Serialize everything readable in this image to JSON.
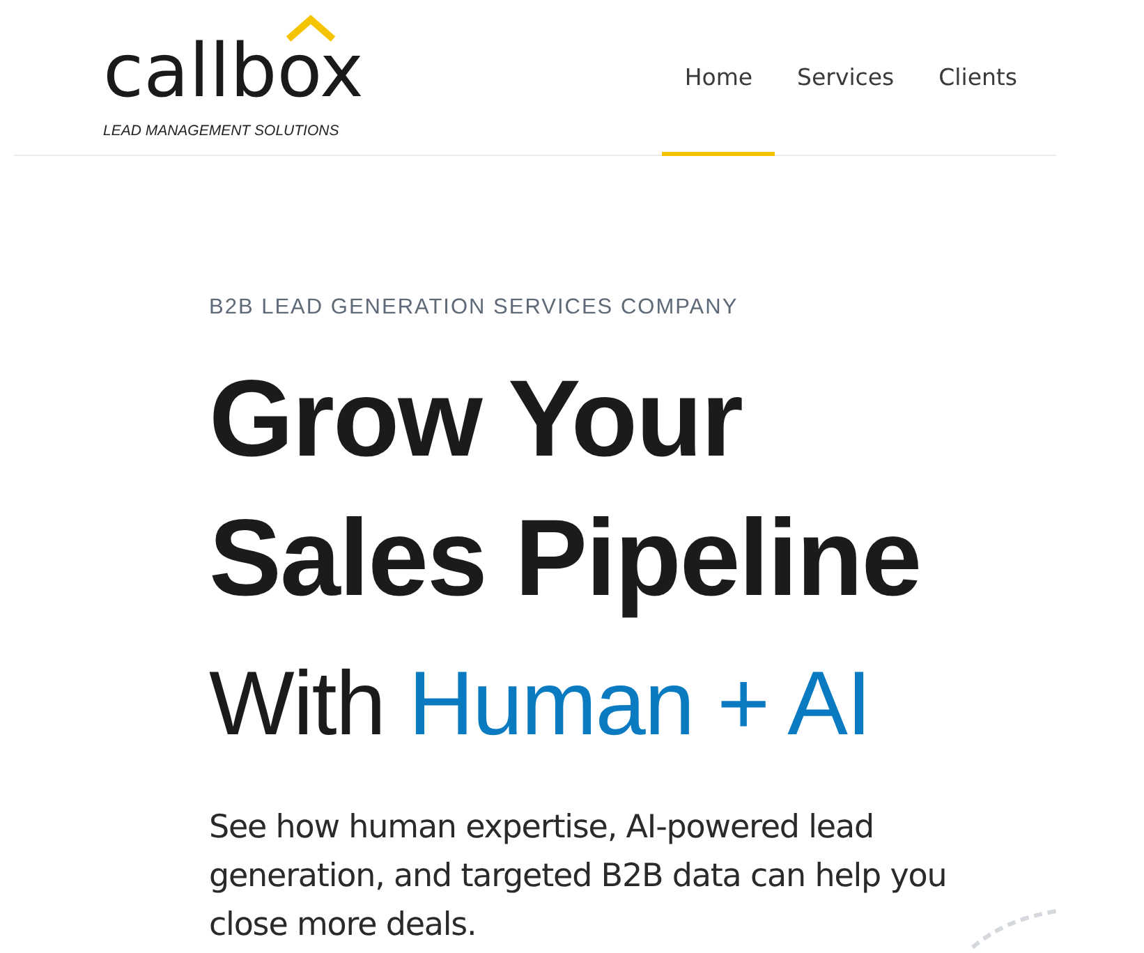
{
  "header": {
    "logo": "callbox",
    "tagline": "LEAD MANAGEMENT SOLUTIONS",
    "nav": [
      {
        "label": "Home",
        "selected": true
      },
      {
        "label": "Services",
        "selected": false
      },
      {
        "label": "Clients",
        "selected": false
      }
    ]
  },
  "hero": {
    "eyebrow": "B2B LEAD GENERATION SERVICES COMPANY",
    "heading": {
      "lines": [
        "Grow Your",
        "Sales Pipeline"
      ],
      "prefix": "With",
      "highlight": "Human + AI"
    },
    "description": "See how human expertise, AI-powered lead generation, and targeted B2B data can help you close more deals."
  }
}
